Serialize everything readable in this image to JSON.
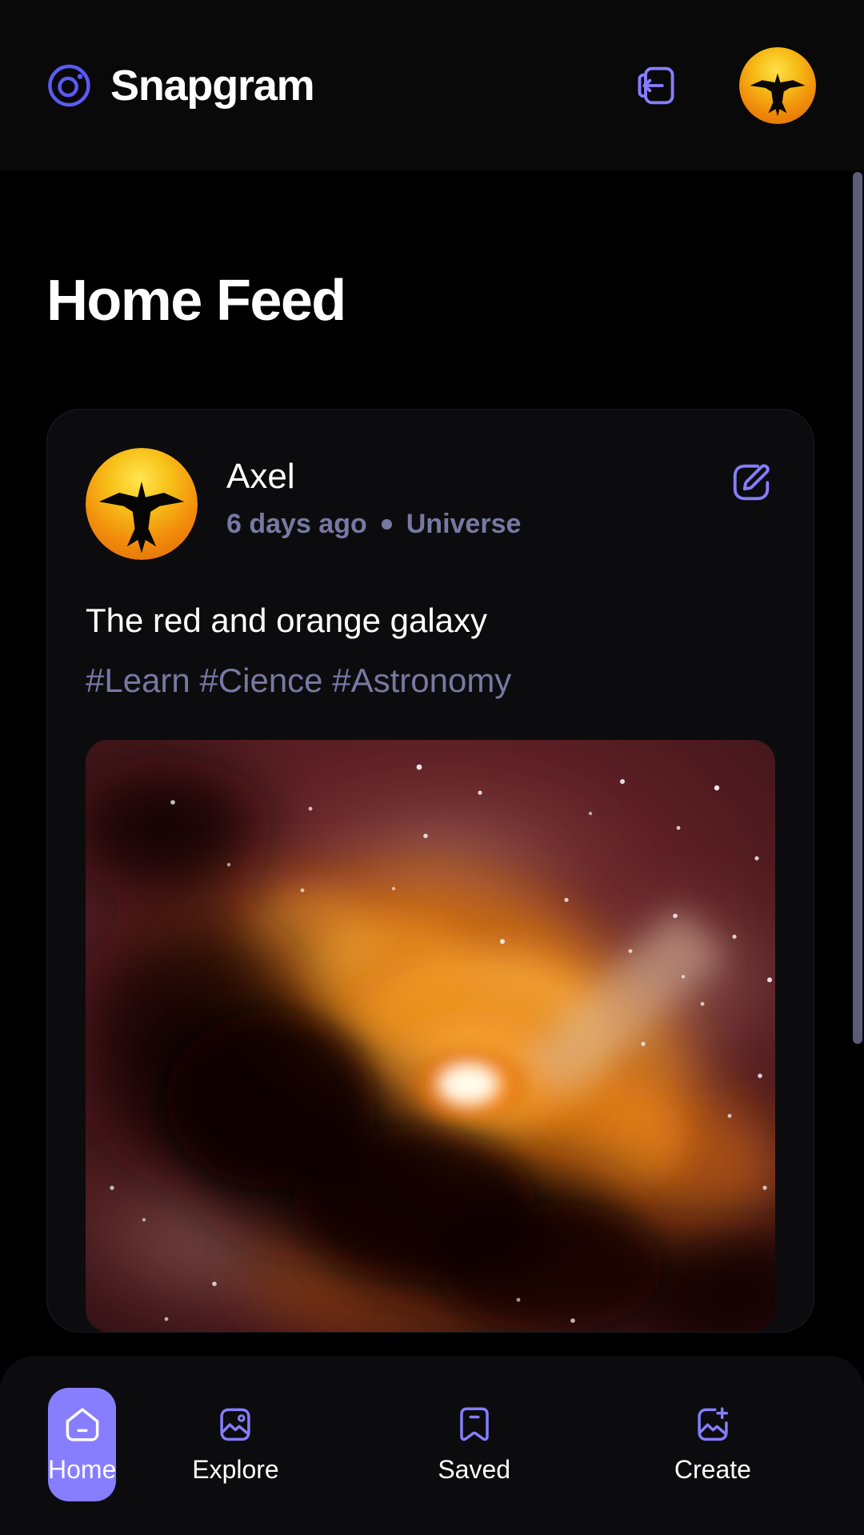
{
  "app": {
    "brand_name": "Snapgram",
    "logo_icon": "camera-circle-icon",
    "accent_color": "#877eff",
    "muted_color": "#7878a3",
    "background_color": "#000000",
    "card_color": "#0c0c0e"
  },
  "topbar": {
    "logout_icon": "logout-icon",
    "avatar_icon": "user-avatar-bird"
  },
  "page": {
    "title": "Home Feed"
  },
  "post": {
    "author": "Axel",
    "timestamp": "6 days ago",
    "location": "Universe",
    "separator_icon": "dot-separator",
    "edit_icon": "edit-pencil-icon",
    "caption": "The red and orange galaxy",
    "tags": "#Learn #Cience #Astronomy",
    "image_alt": "red and orange nebula galaxy"
  },
  "bottom_nav": {
    "items": [
      {
        "label": "Home",
        "icon": "home-icon",
        "active": true
      },
      {
        "label": "Explore",
        "icon": "image-gallery-icon",
        "active": false
      },
      {
        "label": "Saved",
        "icon": "bookmark-icon",
        "active": false
      },
      {
        "label": "Create",
        "icon": "image-plus-icon",
        "active": false
      }
    ]
  },
  "scrollbar": {
    "orientation": "vertical",
    "color": "#5c5c78"
  }
}
